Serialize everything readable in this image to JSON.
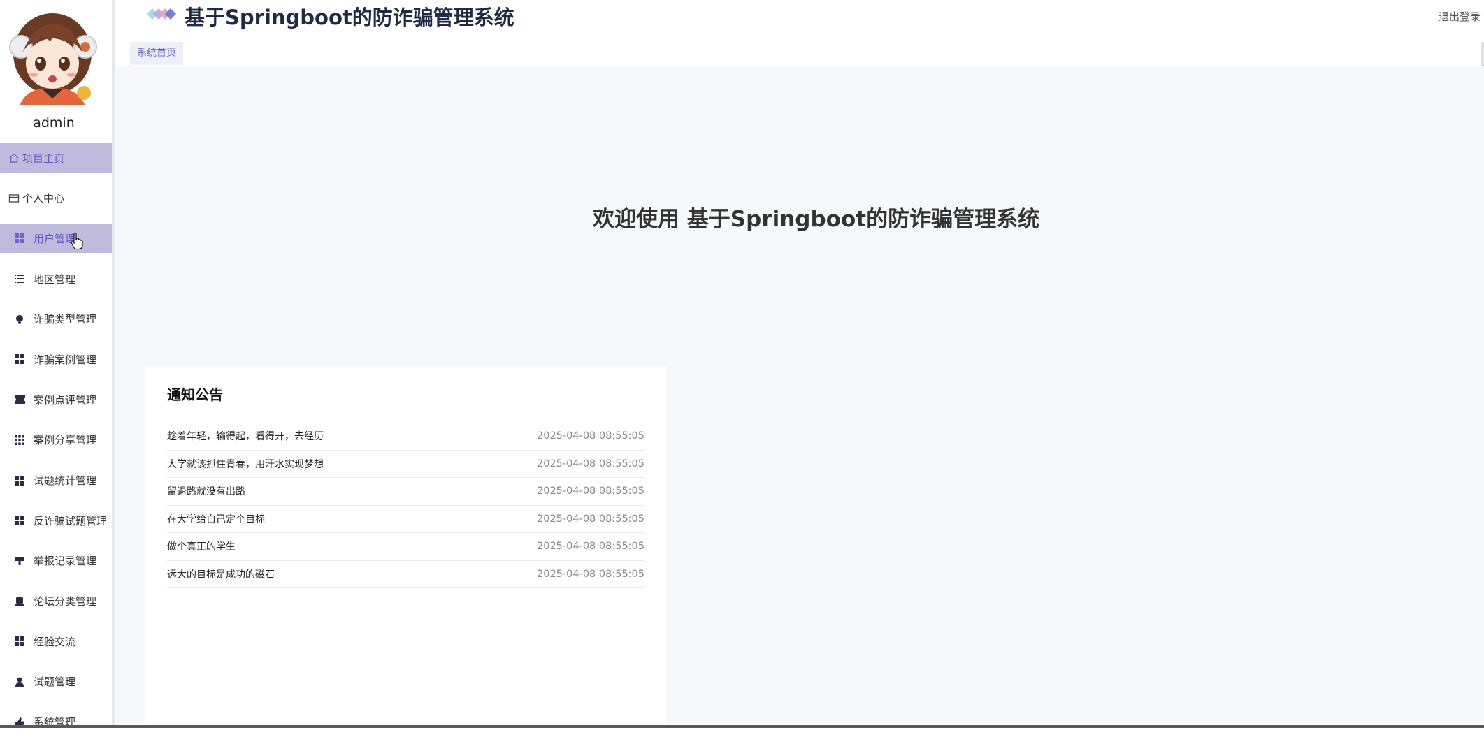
{
  "app": {
    "title": "基于Springboot的防诈骗管理系统",
    "logout_label": "退出登录"
  },
  "user": {
    "name": "admin"
  },
  "sidebar": {
    "items": [
      {
        "label": "项目主页",
        "icon": "home-icon",
        "highlight": true
      },
      {
        "label": "个人中心",
        "icon": "card-icon",
        "highlight": false
      },
      {
        "label": "用户管理",
        "icon": "grid-icon",
        "highlight": true
      },
      {
        "label": "地区管理",
        "icon": "list-icon",
        "highlight": false
      },
      {
        "label": "诈骗类型管理",
        "icon": "bulb-icon",
        "highlight": false
      },
      {
        "label": "诈骗案例管理",
        "icon": "grid-icon",
        "highlight": false
      },
      {
        "label": "案例点评管理",
        "icon": "ticket-icon",
        "highlight": false
      },
      {
        "label": "案例分享管理",
        "icon": "apps-icon",
        "highlight": false
      },
      {
        "label": "试题统计管理",
        "icon": "grid-icon",
        "highlight": false
      },
      {
        "label": "反诈骗试题管理",
        "icon": "grid-icon",
        "highlight": false
      },
      {
        "label": "举报记录管理",
        "icon": "brush-icon",
        "highlight": false
      },
      {
        "label": "论坛分类管理",
        "icon": "printer-icon",
        "highlight": false
      },
      {
        "label": "经验交流",
        "icon": "grid-icon",
        "highlight": false
      },
      {
        "label": "试题管理",
        "icon": "user-icon",
        "highlight": false
      },
      {
        "label": "系统管理",
        "icon": "thumb-icon",
        "highlight": false
      }
    ]
  },
  "tabs": [
    {
      "label": "系统首页",
      "active": true
    }
  ],
  "main": {
    "welcome": "欢迎使用 基于Springboot的防诈骗管理系统"
  },
  "notice": {
    "title": "通知公告",
    "items": [
      {
        "title": "趁着年轻，输得起，看得开，去经历",
        "date": "2025-04-08 08:55:05"
      },
      {
        "title": "大学就该抓住青春，用汗水实现梦想",
        "date": "2025-04-08 08:55:05"
      },
      {
        "title": "留退路就没有出路",
        "date": "2025-04-08 08:55:05"
      },
      {
        "title": "在大学给自己定个目标",
        "date": "2025-04-08 08:55:05"
      },
      {
        "title": "做个真正的学生",
        "date": "2025-04-08 08:55:05"
      },
      {
        "title": "远大的目标是成功的磁石",
        "date": "2025-04-08 08:55:05"
      }
    ]
  },
  "colors": {
    "accent": "#5e54c4",
    "highlight_bg": "#c0bbdc",
    "main_bg": "#f7f8fc",
    "title_color": "#1f2a44"
  }
}
